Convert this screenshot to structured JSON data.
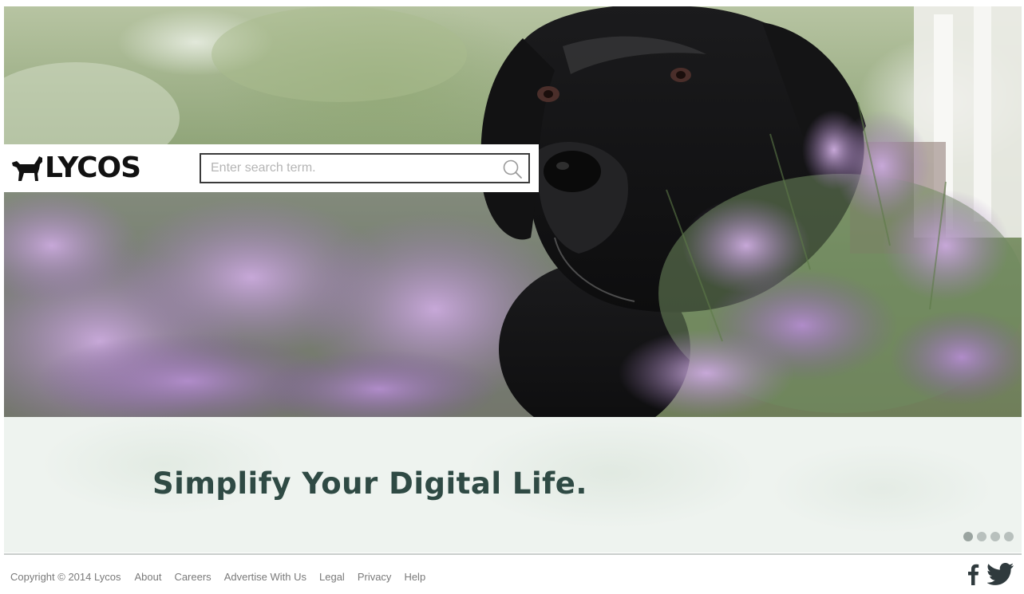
{
  "brand": {
    "logo_text": "LYCOS",
    "logo_icon": "dog-icon"
  },
  "search": {
    "placeholder": "Enter search term.",
    "value": "",
    "icon": "search-icon"
  },
  "hero": {
    "tagline": "Simplify Your Digital Life."
  },
  "carousel": {
    "dot_count": 4,
    "active_index": 0
  },
  "footer": {
    "copyright": "Copyright © 2014 Lycos",
    "links": [
      "About",
      "Careers",
      "Advertise With Us",
      "Legal",
      "Privacy",
      "Help"
    ],
    "social": [
      "facebook-icon",
      "twitter-icon"
    ]
  },
  "colors": {
    "tagline": "#2f4a44",
    "logo": "#111111",
    "footer_text": "#7a7a7a",
    "band_background": "#eef3ef"
  }
}
